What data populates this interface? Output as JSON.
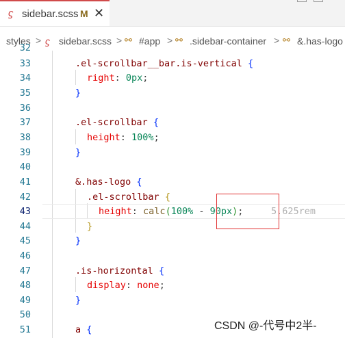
{
  "tab": {
    "title": "sidebar.scss",
    "modified": "M",
    "close": "✕"
  },
  "breadcrumb": {
    "items": [
      "styles",
      "sidebar.scss",
      "#app",
      ".sidebar-container",
      "&.has-logo"
    ],
    "separator": ">"
  },
  "editor": {
    "current_line": 43,
    "hint": "5.625rem",
    "lines": [
      {
        "n": "32",
        "text": ""
      },
      {
        "n": "33",
        "text": ".el-scrollbar__bar.is-vertical {"
      },
      {
        "n": "34",
        "text": "right: 0px;"
      },
      {
        "n": "35",
        "text": "}"
      },
      {
        "n": "36",
        "text": ""
      },
      {
        "n": "37",
        "text": ".el-scrollbar {"
      },
      {
        "n": "38",
        "text": "height: 100%;"
      },
      {
        "n": "39",
        "text": "}"
      },
      {
        "n": "40",
        "text": ""
      },
      {
        "n": "41",
        "text": "&.has-logo {"
      },
      {
        "n": "42",
        "text": ".el-scrollbar {"
      },
      {
        "n": "43",
        "text": "height: calc(100% - 90px);"
      },
      {
        "n": "44",
        "text": "}"
      },
      {
        "n": "45",
        "text": "}"
      },
      {
        "n": "46",
        "text": ""
      },
      {
        "n": "47",
        "text": ".is-horizontal {"
      },
      {
        "n": "48",
        "text": "display: none;"
      },
      {
        "n": "49",
        "text": "}"
      },
      {
        "n": "50",
        "text": ""
      },
      {
        "n": "51",
        "text": "a {"
      }
    ]
  },
  "watermark": "CSDN @-代号中2半-",
  "colors": {
    "accent": "#d04a4a",
    "annotation_box": "#e03030"
  }
}
